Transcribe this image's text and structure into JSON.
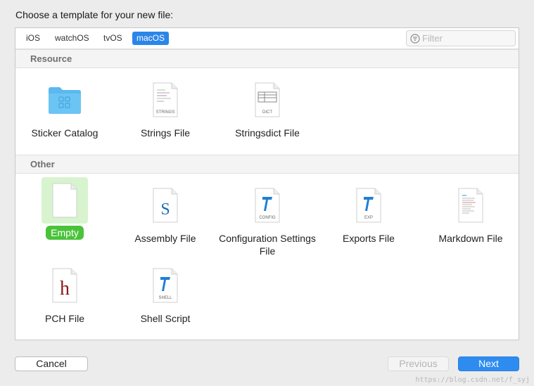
{
  "header": {
    "title": "Choose a template for your new file:"
  },
  "tabs": [
    {
      "label": "iOS"
    },
    {
      "label": "watchOS"
    },
    {
      "label": "tvOS"
    },
    {
      "label": "macOS"
    }
  ],
  "active_tab": "macOS",
  "filter": {
    "placeholder": "Filter",
    "value": ""
  },
  "sections": {
    "resource": {
      "title": "Resource",
      "items": [
        {
          "label": "Sticker Catalog",
          "icon": "folder-icon"
        },
        {
          "label": "Strings File",
          "icon": "strings-file-icon",
          "badge": "STRINGS"
        },
        {
          "label": "Stringsdict File",
          "icon": "stringsdict-file-icon",
          "badge": "DICT"
        }
      ]
    },
    "other": {
      "title": "Other",
      "items": [
        {
          "label": "Empty",
          "icon": "empty-file-icon",
          "selected": true
        },
        {
          "label": "Assembly File",
          "icon": "assembly-file-icon",
          "glyph": "S"
        },
        {
          "label": "Configuration Settings File",
          "icon": "config-file-icon",
          "badge": "CONFIG"
        },
        {
          "label": "Exports File",
          "icon": "exports-file-icon",
          "badge": "EXP"
        },
        {
          "label": "Markdown File",
          "icon": "markdown-file-icon"
        },
        {
          "label": "PCH File",
          "icon": "pch-file-icon",
          "glyph": "h"
        },
        {
          "label": "Shell Script",
          "icon": "shell-script-icon",
          "badge": "SHELL"
        }
      ]
    }
  },
  "buttons": {
    "cancel": "Cancel",
    "previous": "Previous",
    "next": "Next"
  },
  "watermark": "https://blog.csdn.net/f_syj",
  "colors": {
    "accent": "#2b86e9",
    "selected_label": "#4ac23a",
    "selected_bg": "#d8f4cf",
    "folder": "#5bb8f0",
    "pch_glyph": "#8b1a1a",
    "swift_blue": "#1f7fd6"
  }
}
